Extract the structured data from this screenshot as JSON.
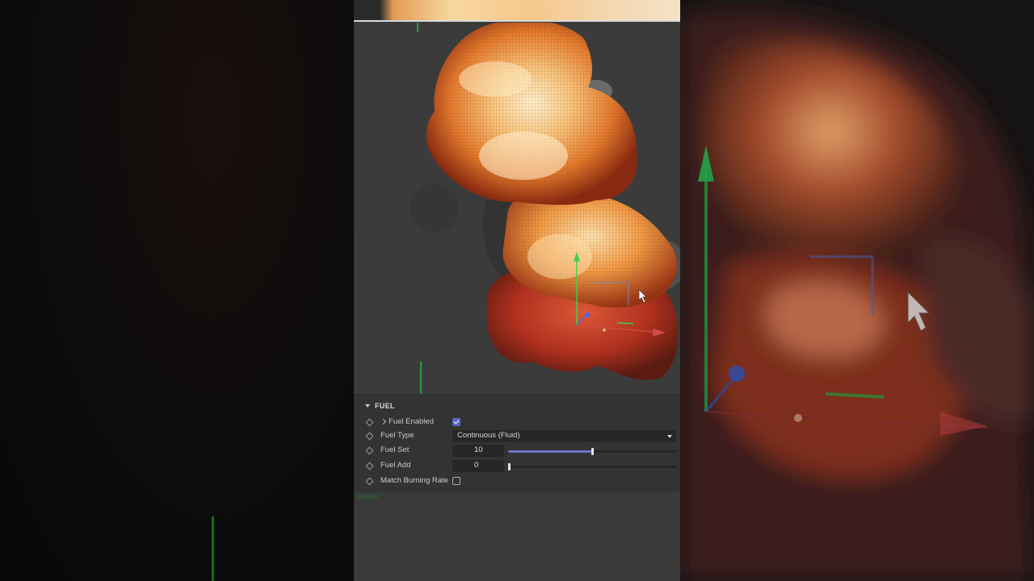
{
  "attributes": {
    "section_title": "FUEL",
    "rows": [
      {
        "label": "Fuel Enabled",
        "checked": true
      },
      {
        "label": "Fuel Type",
        "value": "Continuous (Fluid)"
      },
      {
        "label": "Fuel Set",
        "value": "10",
        "slider_fraction": 0.5
      },
      {
        "label": "Fuel Add",
        "value": "0",
        "slider_fraction": 0.0
      },
      {
        "label": "Match Burning Rate",
        "checked": false
      }
    ]
  },
  "colors": {
    "accent": "#5a67c7",
    "panel_bg": "#333333",
    "viewport_bg": "#3b3b3b",
    "fire_core": "#f7d49a",
    "fire_outer": "#b8321a"
  },
  "icons": [
    "keyframe-diamond-icon",
    "expand-chevron-icon",
    "checkbox-icon",
    "dropdown-arrow-icon",
    "mouse-cursor-icon",
    "transform-gizmo-icon"
  ]
}
